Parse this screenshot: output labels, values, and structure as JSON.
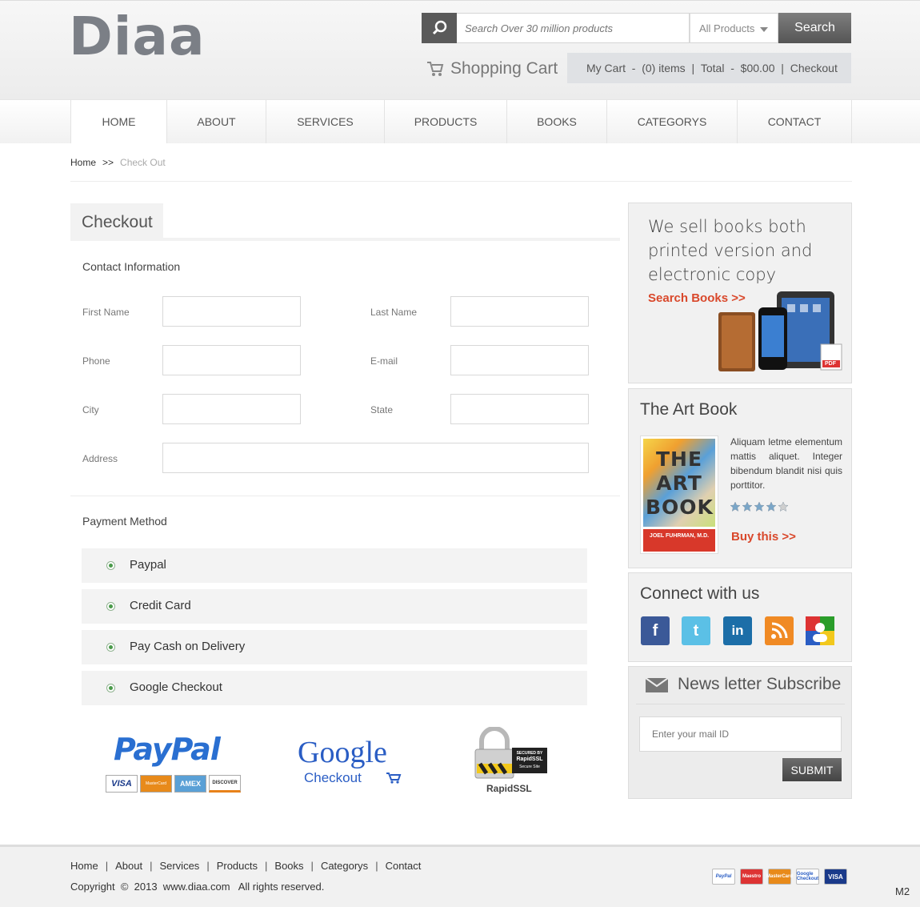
{
  "header": {
    "logo": "Diaa",
    "search_placeholder": "Search Over 30 million products",
    "category_select": "All Products",
    "search_button": "Search",
    "cart_label": "Shopping Cart",
    "cart_bar": {
      "my_cart": "My Cart  -  (0) items",
      "sep1": "  |  ",
      "total": "Total  -  $00.00",
      "sep2": "  |  ",
      "checkout": "Checkout"
    }
  },
  "nav": [
    {
      "label": "HOME",
      "width": 121,
      "active": true
    },
    {
      "label": "ABOUT",
      "width": 124
    },
    {
      "label": "SERVICES",
      "width": 148
    },
    {
      "label": "PRODUCTS",
      "width": 153
    },
    {
      "label": "BOOKS",
      "width": 125
    },
    {
      "label": "CATEGORYS",
      "width": 163
    },
    {
      "label": "CONTACT",
      "width": 143
    }
  ],
  "breadcrumb": {
    "home": "Home",
    "sep": ">>",
    "current": "Check Out"
  },
  "checkout": {
    "title": "Checkout",
    "contact_heading": "Contact Information",
    "fields": {
      "first_name": "First Name",
      "last_name": "Last Name",
      "phone": "Phone",
      "email": "E-mail",
      "city": "City",
      "state": "State",
      "address": "Address"
    },
    "payment_heading": "Payment Method",
    "payment_options": [
      "Paypal",
      "Credit Card",
      "Pay Cash on Delivery",
      "Google Checkout"
    ]
  },
  "logos": {
    "paypal": "PayPal",
    "paypal_cards": [
      "VISA",
      "MasterCard",
      "AMEX",
      "DISCOVER"
    ],
    "google": "Google",
    "google_sub": "Checkout",
    "ssl_top": "SECURED BY",
    "ssl_mid": "RapidSSL",
    "ssl_sub": "Secure Site",
    "ssl_name": "RapidSSL"
  },
  "sidebar": {
    "promo_text": "We sell books both printed version and electronic copy",
    "promo_link": "Search Books  >>",
    "pdf_label": "PDF",
    "art_title": "The Art Book",
    "book_cover_title": "THE ART BOOK",
    "book_cover_author": "JOEL FUHRMAN, M.D.",
    "art_desc": "Aliquam letme elementum mattis aliquet. Integer bibendum blandit nisi quis porttitor.",
    "rating": 4,
    "rating_max": 5,
    "buy_link": "Buy this  >>",
    "connect_title": "Connect with us",
    "social": [
      {
        "name": "facebook-icon",
        "glyph": "f",
        "color": "#3b5998"
      },
      {
        "name": "twitter-icon",
        "glyph": "t",
        "color": "#5bc0e6"
      },
      {
        "name": "linkedin-icon",
        "glyph": "in",
        "color": "#1c6ea8"
      },
      {
        "name": "rss-icon",
        "glyph": "∷",
        "color": "#f08a24"
      },
      {
        "name": "google-icon",
        "glyph": "g",
        "color": "#ffffff"
      }
    ],
    "newsletter_title": "News letter Subscribe",
    "newsletter_placeholder": "Enter your mail ID",
    "submit": "SUBMIT"
  },
  "footer": {
    "links": [
      "Home",
      "About",
      "Services",
      "Products",
      "Books",
      "Categorys",
      "Contact"
    ],
    "copyright": "Copyright  ©  2013  www.diaa.com   All rights reserved.",
    "cards": [
      "PayPal",
      "Maestro",
      "MasterCard",
      "Google Checkout",
      "VISA"
    ],
    "badge": "M2"
  },
  "colors": {
    "accent_red": "#d9482b",
    "radio_green": "#4a9a4a"
  }
}
